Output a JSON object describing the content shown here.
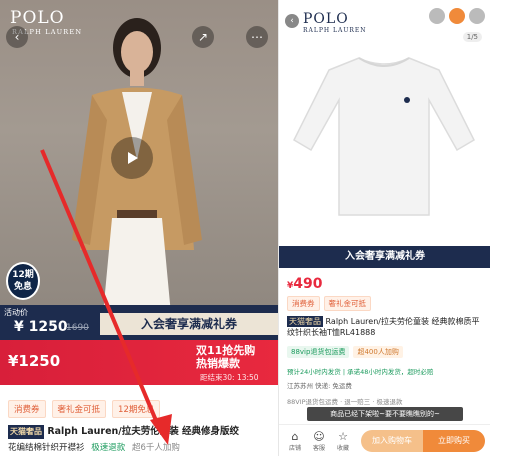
{
  "left": {
    "brand": "POLO",
    "brand_sub": "RALPH LAUREN",
    "back_icon": "chevron-left-icon",
    "share_icon": "share-icon",
    "more_icon": "more-dots-icon",
    "installment": {
      "line1": "12期",
      "line2": "免息"
    },
    "activity_label": "活动价",
    "price_now": "¥ 1250",
    "price_orig": "1690",
    "member_banner": "入会奢享满减礼券",
    "red_price": "¥1250",
    "promo_line1": "双11抢先购",
    "promo_line2": "热销爆款",
    "promo_time": "距结束30: 13:50",
    "tags": [
      "消费券",
      "奢礼金可抵",
      "12期免息"
    ],
    "title_prefix": "天猫奢品",
    "title": "Ralph Lauren/拉夫劳伦女装 经典修身版绞",
    "subtitle": "花编结棉针织开襟衫",
    "sub_green": "极速退款",
    "sub_grey": "超6千人加购"
  },
  "right": {
    "brand": "POLO",
    "brand_sub": "RALPH LAUREN",
    "page_indicator": "1/5",
    "member_banner": "入会奢享满减礼券",
    "price": "490",
    "tags": [
      "消费券",
      "奢礼金可抵"
    ],
    "title_prefix": "天猫奢品",
    "title": "Ralph Lauren/拉夫劳伦童装 经典款棉质平纹针织长袖T恤RL41888",
    "chips": [
      "88vip退货包运费",
      "超400人加购"
    ],
    "shipping": "预计24小时内发货 | 承诺48小时内发货，超时必赔",
    "location": "江苏苏州  快递: 免运费",
    "vip_line": "88VIP退货包运费 · 退一赔三 · 极速退款",
    "toast": "商品已经下架啦~要不要瞧瞧别的~",
    "bottom": {
      "store": "店铺",
      "service": "客服",
      "favorite": "收藏",
      "add_cart": "加入购物车",
      "buy_now": "立即购买"
    }
  }
}
